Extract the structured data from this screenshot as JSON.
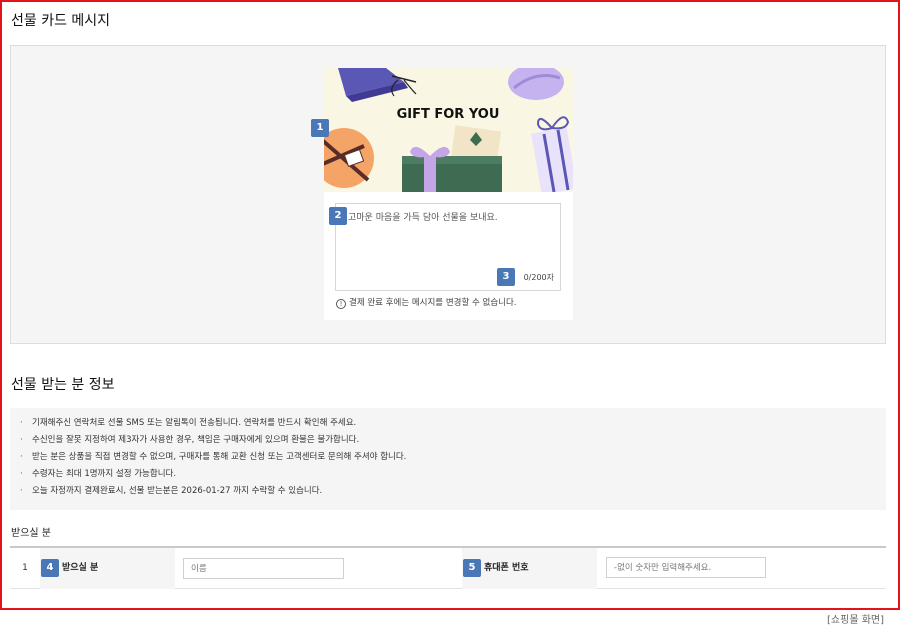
{
  "card_section": {
    "title": "선물 카드 메시지",
    "card_image_text": "GIFT FOR YOU",
    "message_placeholder": "고마운 마음을 가득 담아 선물을 보내요.",
    "counter": "0/200자",
    "notice": "결제 완료 후에는 메시지를 변경할 수 없습니다.",
    "notice_icon": "info-circle-icon"
  },
  "recipient_section": {
    "title": "선물 받는 분 정보",
    "guide_items": [
      "기재해주신 연락처로 선물 SMS 또는 알림톡이 전송됩니다. 연락처를 반드시 확인해 주세요.",
      "수신인을 잘못 지정하여 제3자가 사용한 경우, 책임은 구매자에게 있으며 환불은 불가합니다.",
      "받는 분은 상품을 직접 변경할 수 없으며, 구매자를 통해 교환 신청 또는 고객센터로 문의해 주셔야 합니다.",
      "수령자는 최대 1명까지 설정 가능합니다.",
      "오늘 자정까지 결제완료시, 선물 받는분은 2026-01-27 까지 수락할 수 있습니다."
    ],
    "subtitle": "받으실 분",
    "row": {
      "index": "1",
      "name_label": "받으실 분",
      "name_placeholder": "이름",
      "phone_label": "휴대폰 번호",
      "phone_placeholder": "-없이 숫자만 입력해주세요."
    }
  },
  "badges": [
    "1",
    "2",
    "3",
    "4",
    "5"
  ],
  "caption": "[쇼핑몰 화면]",
  "colors": {
    "frame_border": "#e1141b",
    "badge": "#4a78b7",
    "panel_bg": "#f5f5f5",
    "card_bg": "#faf6e4"
  }
}
